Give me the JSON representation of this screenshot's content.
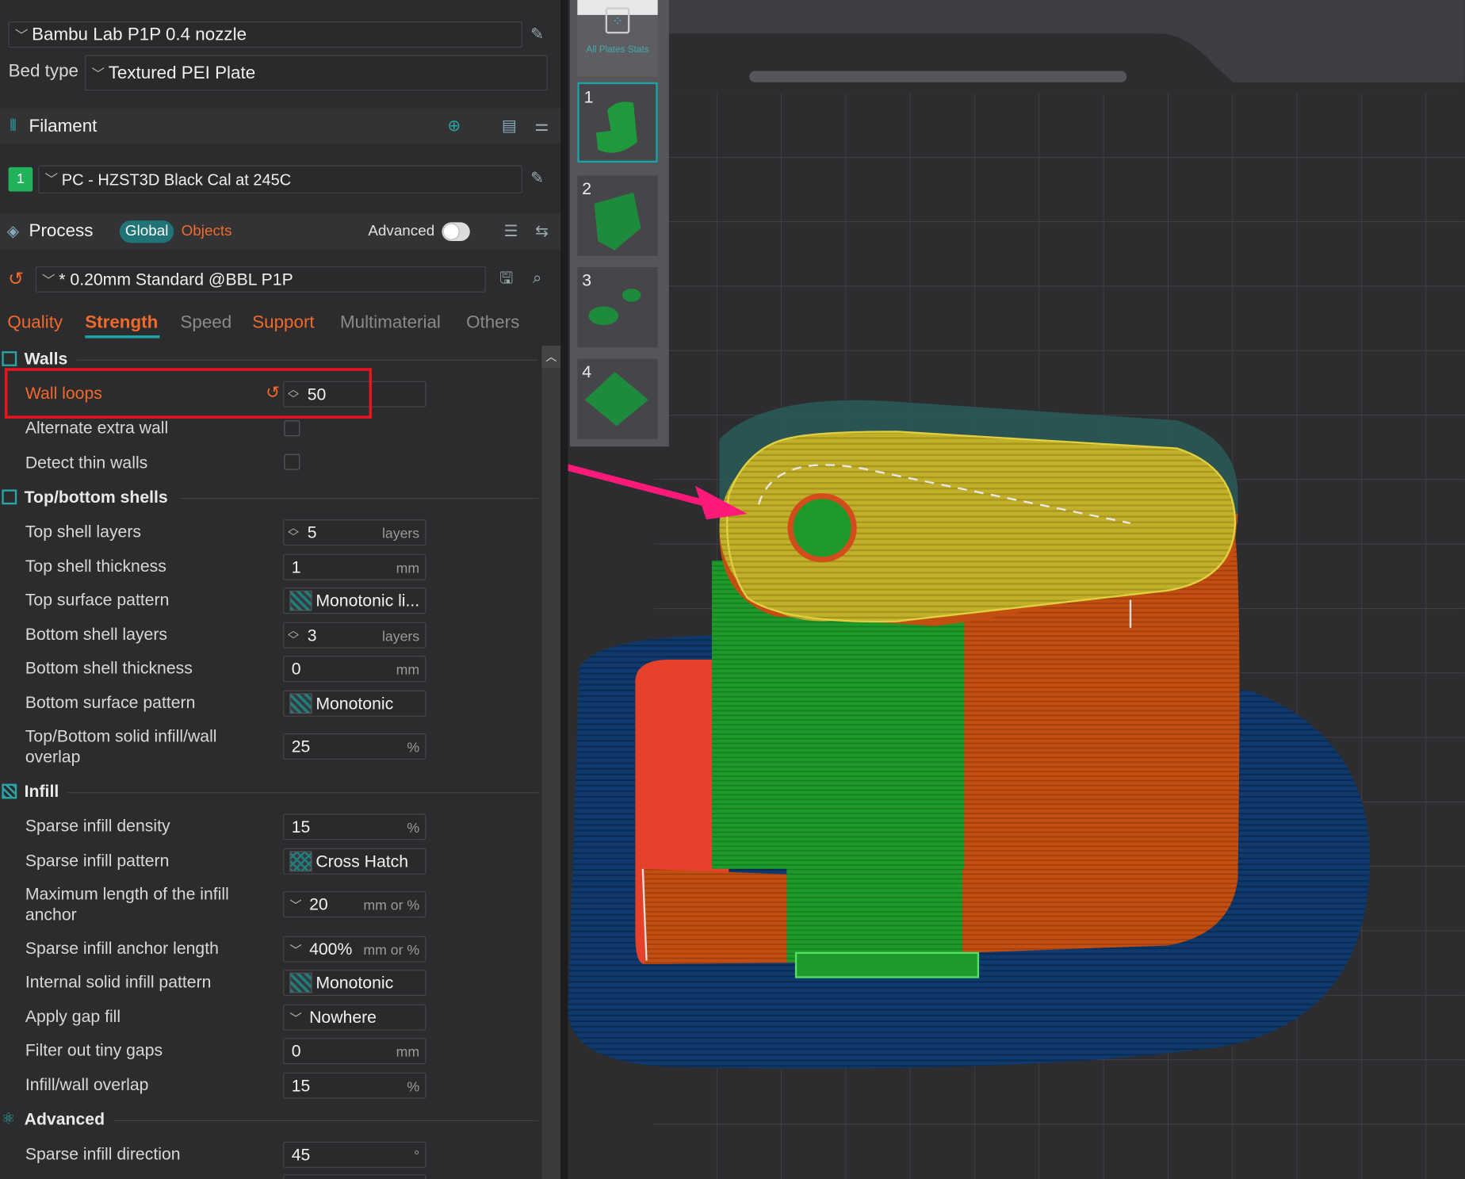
{
  "printer": {
    "name": "Bambu Lab P1P 0.4 nozzle",
    "bed_type_label": "Bed type",
    "bed_type": "Textured PEI Plate"
  },
  "filament": {
    "section_title": "Filament",
    "slot": "1",
    "slot_color": "#21b35a",
    "name": "PC - HZST3D Black Cal at 245C"
  },
  "process": {
    "section_title": "Process",
    "global_label": "Global",
    "objects_label": "Objects",
    "advanced_label": "Advanced",
    "preset": "* 0.20mm Standard @BBL P1P"
  },
  "tabs": [
    {
      "label": "Quality",
      "state": "modified"
    },
    {
      "label": "Strength",
      "state": "active"
    },
    {
      "label": "Speed",
      "state": "normal"
    },
    {
      "label": "Support",
      "state": "modified"
    },
    {
      "label": "Multimaterial",
      "state": "normal"
    },
    {
      "label": "Others",
      "state": "normal"
    }
  ],
  "groups": {
    "walls": "Walls",
    "topbottom": "Top/bottom shells",
    "infill": "Infill",
    "advanced": "Advanced"
  },
  "settings": {
    "wall_loops": {
      "label": "Wall loops",
      "value": "50"
    },
    "alternate_extra_wall": {
      "label": "Alternate extra wall"
    },
    "detect_thin_walls": {
      "label": "Detect thin walls"
    },
    "top_shell_layers": {
      "label": "Top shell layers",
      "value": "5",
      "unit": "layers"
    },
    "top_shell_thickness": {
      "label": "Top shell thickness",
      "value": "1",
      "unit": "mm"
    },
    "top_surface_pattern": {
      "label": "Top surface pattern",
      "value": "Monotonic li..."
    },
    "bottom_shell_layers": {
      "label": "Bottom shell layers",
      "value": "3",
      "unit": "layers"
    },
    "bottom_shell_thickness": {
      "label": "Bottom shell thickness",
      "value": "0",
      "unit": "mm"
    },
    "bottom_surface_pattern": {
      "label": "Bottom surface pattern",
      "value": "Monotonic"
    },
    "solid_overlap": {
      "label_1": "Top/Bottom solid infill/wall",
      "label_2": "overlap",
      "value": "25",
      "unit": "%"
    },
    "sparse_infill_density": {
      "label": "Sparse infill density",
      "value": "15",
      "unit": "%"
    },
    "sparse_infill_pattern": {
      "label": "Sparse infill pattern",
      "value": "Cross Hatch"
    },
    "max_anchor": {
      "label_1": "Maximum length of the infill",
      "label_2": "anchor",
      "value": "20",
      "unit": "mm or %"
    },
    "anchor_length": {
      "label": "Sparse infill anchor length",
      "value": "400%",
      "unit": "mm or %"
    },
    "internal_solid_pattern": {
      "label": "Internal solid infill pattern",
      "value": "Monotonic"
    },
    "gap_fill": {
      "label": "Apply gap fill",
      "value": "Nowhere"
    },
    "filter_gaps": {
      "label": "Filter out tiny gaps",
      "value": "0",
      "unit": "mm"
    },
    "infill_wall_overlap": {
      "label": "Infill/wall overlap",
      "value": "15",
      "unit": "%"
    },
    "infill_direction": {
      "label": "Sparse infill direction",
      "value": "45",
      "unit": "°"
    }
  },
  "plates": {
    "all_label": "All Plates Stats",
    "items": [
      "1",
      "2",
      "3",
      "4"
    ]
  },
  "colors": {
    "accent_orange": "#f26a2a",
    "accent_teal": "#1aa3a8",
    "highlight_red": "#e8141e",
    "arrow_pink": "#ff1a7a",
    "model_yellow": "#c8b52a",
    "model_orange": "#c24e12",
    "model_green": "#1e9a2c",
    "model_red": "#e8402a",
    "brim_blue": "#0f3a6e"
  }
}
